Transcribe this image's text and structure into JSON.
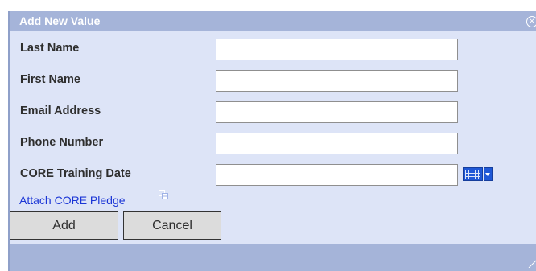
{
  "dialog": {
    "title": "Add New Value",
    "close_icon": "close-circle-icon"
  },
  "form": {
    "fields": [
      {
        "label": "Last Name",
        "value": ""
      },
      {
        "label": "First Name",
        "value": ""
      },
      {
        "label": "Email Address",
        "value": ""
      },
      {
        "label": "Phone Number",
        "value": ""
      },
      {
        "label": "CORE Training Date",
        "value": ""
      }
    ],
    "calendar_icon": "calendar-icon",
    "attach_link": "Attach CORE Pledge",
    "attach_icon": "attach-icon"
  },
  "buttons": {
    "add_label": "Add",
    "cancel_label": "Cancel"
  },
  "footer": {
    "resize_icon": "resize-grip-icon"
  },
  "colors": {
    "titlebar": "#a5b4d9",
    "body": "#dde4f7",
    "link": "#1a35d6",
    "calendar": "#1f58d6"
  }
}
